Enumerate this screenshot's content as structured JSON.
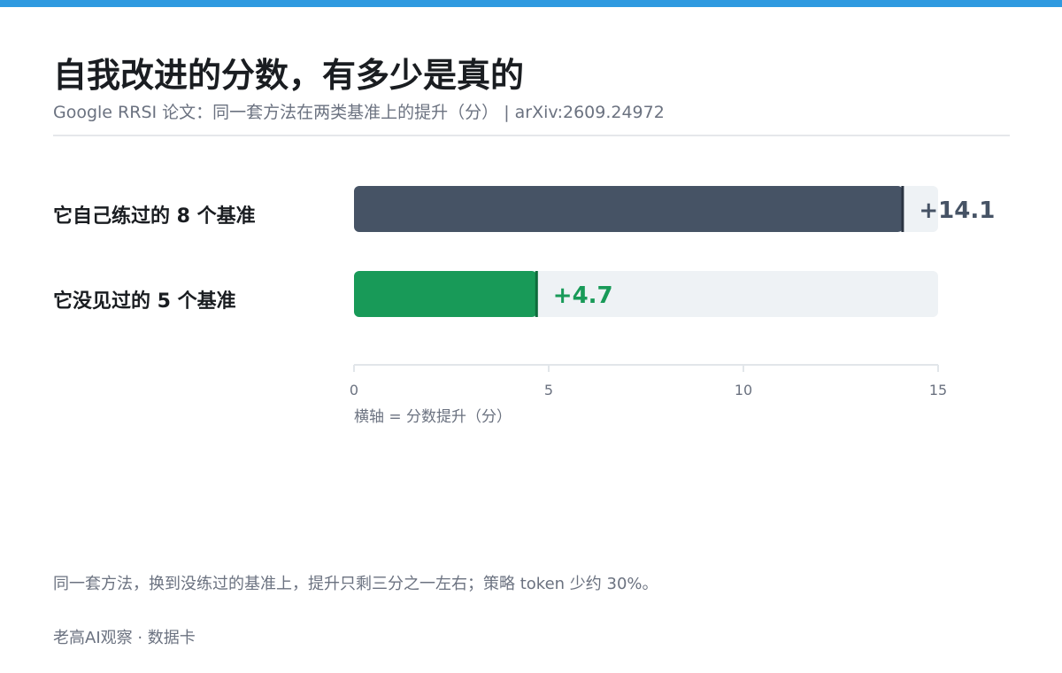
{
  "header": {
    "title": "自我改进的分数，有多少是真的",
    "subtitle": "Google RRSI 论文：同一套方法在两类基准上的提升（分） | arXiv:2609.24972"
  },
  "colors": {
    "accent_strip": "#2f9ae0",
    "track": "#eef2f5",
    "axis": "#e2e6ea",
    "muted_text": "#6b7280"
  },
  "chart_data": {
    "type": "bar",
    "orientation": "horizontal",
    "categories": [
      "它自己练过的 8 个基准",
      "它没见过的 5 个基准"
    ],
    "values": [
      14.1,
      4.7
    ],
    "value_labels": [
      "+14.1",
      "+4.7"
    ],
    "bar_colors": [
      "#465365",
      "#189a58"
    ],
    "marker_colors": [
      "#2b3442",
      "#0d6b3b"
    ],
    "xlim": [
      0,
      15
    ],
    "xticks": [
      0,
      5,
      10,
      15
    ],
    "xlabel": "横轴 = 分数提升（分）",
    "grid": false
  },
  "footer": {
    "note": "同一套方法，换到没练过的基准上，提升只剩三分之一左右；策略 token 少约 30%。",
    "brand": "老高AI观察 · 数据卡"
  }
}
